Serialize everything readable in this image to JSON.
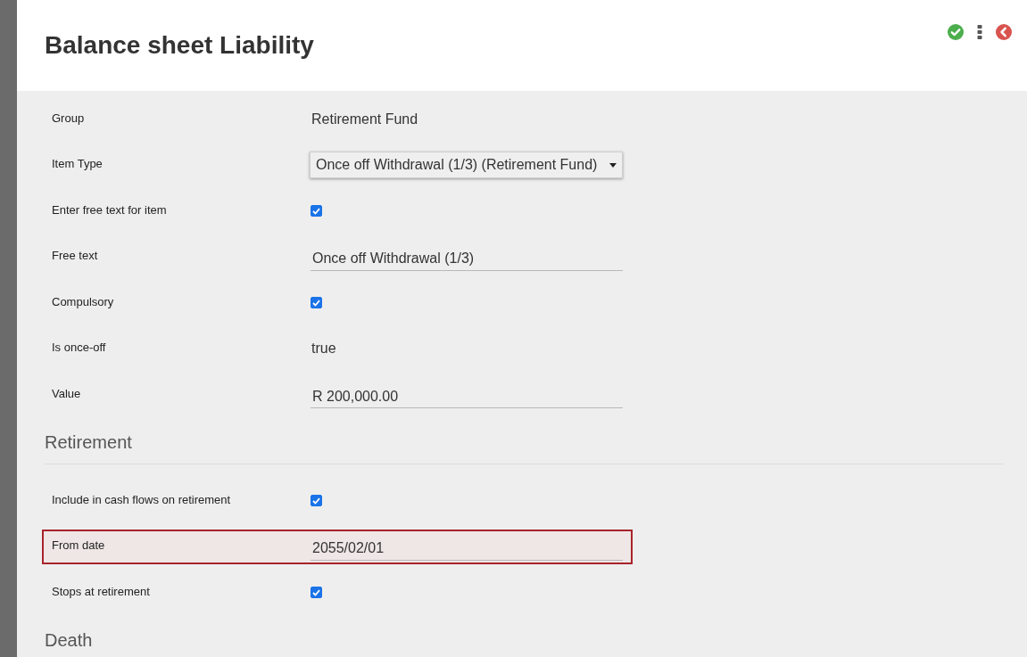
{
  "header": {
    "title": "Balance sheet Liability"
  },
  "sections": [
    {
      "rows": [
        {
          "kind": "text",
          "label": "Group",
          "value": "Retirement Fund",
          "error": false
        },
        {
          "kind": "select",
          "label": "Item Type",
          "value": "Once off Withdrawal (1/3) (Retirement Fund)",
          "error": false
        },
        {
          "kind": "checkbox",
          "label": "Enter free text for item",
          "checked": true,
          "error": false
        },
        {
          "kind": "input",
          "label": "Free text",
          "value": "Once off Withdrawal (1/3)",
          "error": false
        },
        {
          "kind": "checkbox",
          "label": "Compulsory",
          "checked": true,
          "error": false
        },
        {
          "kind": "text",
          "label": "Is once-off",
          "value": "true",
          "error": false
        },
        {
          "kind": "input",
          "label": "Value",
          "value": "R 200,000.00",
          "error": false
        }
      ]
    },
    {
      "title": "Retirement",
      "rows": [
        {
          "kind": "checkbox",
          "label": "Include in cash flows on retirement",
          "checked": true,
          "error": false
        },
        {
          "kind": "input",
          "label": "From date",
          "value": "2055/02/01",
          "error": true
        },
        {
          "kind": "checkbox",
          "label": "Stops at retirement",
          "checked": true,
          "error": false
        }
      ]
    },
    {
      "title": "Death"
    }
  ]
}
